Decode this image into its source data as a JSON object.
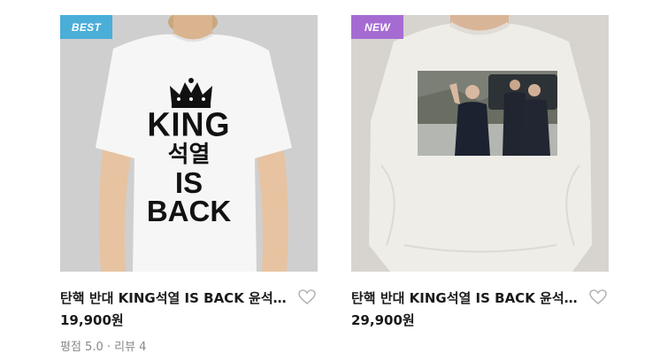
{
  "products": [
    {
      "badge": "BEST",
      "badge_color": "#4aaed9",
      "print": {
        "line1": "KING",
        "line2": "석열",
        "line3": "IS",
        "line4": "BACK"
      },
      "title": "탄핵 반대 KING석열 IS BACK 윤석열 티셔츠",
      "price": "19,900원",
      "rating": "평점 5.0 · 리뷰 4"
    },
    {
      "badge": "NEW",
      "badge_color": "#a66bd3",
      "title": "탄핵 반대 KING석열 IS BACK 윤석열 맨투맨",
      "price": "29,900원"
    }
  ]
}
